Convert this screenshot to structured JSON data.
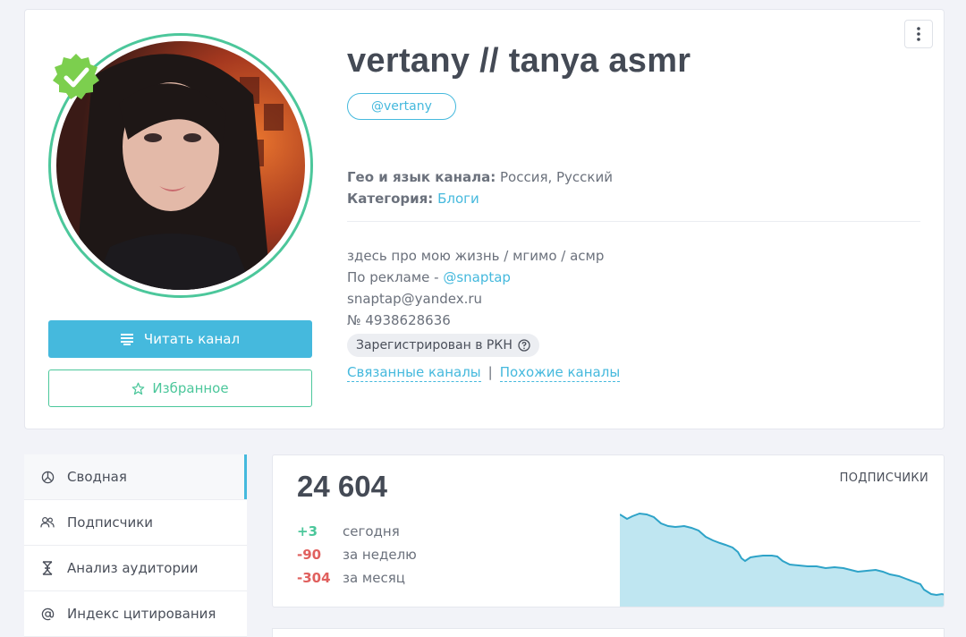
{
  "channel": {
    "title": "vertany // tanya asmr",
    "handle": "@vertany",
    "geo_label": "Гео и язык канала:",
    "geo_value": "Россия, Русский",
    "category_label": "Категория:",
    "category_value": "Блоги",
    "description": {
      "line1": "здесь про мою жизнь / мгимо / асмр",
      "line2_prefix": "По рекламе -",
      "line2_link": "@snaptap",
      "line3": "snaptap@yandex.ru",
      "line4": "№ 4938628636"
    },
    "rkn_badge": "Зарегистрирован в РКН",
    "related_link": "Связанные каналы",
    "similar_link": "Похожие каналы",
    "separator": "|"
  },
  "buttons": {
    "read": "Читать канал",
    "favorite": "Избранное"
  },
  "sidebar": {
    "items": [
      {
        "label": "Сводная",
        "icon": "chart-pie-icon",
        "active": true
      },
      {
        "label": "Подписчики",
        "icon": "users-icon",
        "active": false
      },
      {
        "label": "Анализ аудитории",
        "icon": "dna-icon",
        "active": false
      },
      {
        "label": "Индекс цитирования",
        "icon": "at-icon",
        "active": false
      }
    ]
  },
  "stats": {
    "subscribers": "24 604",
    "label": "ПОДПИСЧИКИ",
    "today_value": "+3",
    "today_label": "сегодня",
    "week_value": "-90",
    "week_label": "за неделю",
    "month_value": "-304",
    "month_label": "за месяц"
  },
  "colors": {
    "accent": "#45b9dd",
    "green": "#4cc79b",
    "red": "#e0605e"
  }
}
